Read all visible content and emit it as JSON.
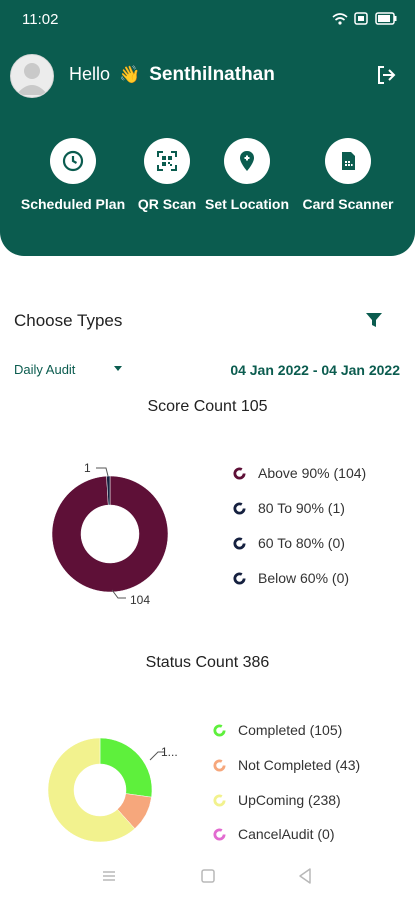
{
  "status_bar": {
    "time": "11:02"
  },
  "header": {
    "greeting": "Hello",
    "wave": "👋",
    "user_name": "Senthilnathan",
    "actions": [
      {
        "label": "Scheduled Plan",
        "icon": "clock-icon"
      },
      {
        "label": "QR Scan",
        "icon": "qr-scan-icon"
      },
      {
        "label": "Set Location",
        "icon": "location-pin-icon"
      },
      {
        "label": "Card Scanner",
        "icon": "sim-card-icon"
      }
    ]
  },
  "filters": {
    "title": "Choose Types",
    "audit_type": "Daily Audit",
    "date_range": "04 Jan 2022 - 04 Jan 2022"
  },
  "colors": {
    "brand": "#0b5c4f",
    "above90": "#5e1037",
    "r80_90": "#15203f",
    "completed": "#5ef03c",
    "not_completed": "#f6a77c",
    "upcoming": "#f2f28e",
    "cancel": "#e26bd0"
  },
  "chart_data": [
    {
      "type": "pie",
      "title": "Score Count 105",
      "series": [
        {
          "name": "Above 90% (104)",
          "value": 104,
          "color": "#5e1037"
        },
        {
          "name": "80 To 90% (1)",
          "value": 1,
          "color": "#15203f"
        },
        {
          "name": "60 To 80% (0)",
          "value": 0,
          "color": "#15203f"
        },
        {
          "name": "Below 60% (0)",
          "value": 0,
          "color": "#15203f"
        }
      ],
      "data_labels": [
        "1",
        "104"
      ],
      "legend_position": "right"
    },
    {
      "type": "pie",
      "title": "Status Count 386",
      "series": [
        {
          "name": "Completed (105)",
          "value": 105,
          "color": "#5ef03c"
        },
        {
          "name": "Not Completed (43)",
          "value": 43,
          "color": "#f6a77c"
        },
        {
          "name": "UpComing (238)",
          "value": 238,
          "color": "#f2f28e"
        },
        {
          "name": "CancelAudit (0)",
          "value": 0,
          "color": "#e26bd0"
        }
      ],
      "data_labels": [
        "1..."
      ],
      "legend_position": "right"
    }
  ]
}
